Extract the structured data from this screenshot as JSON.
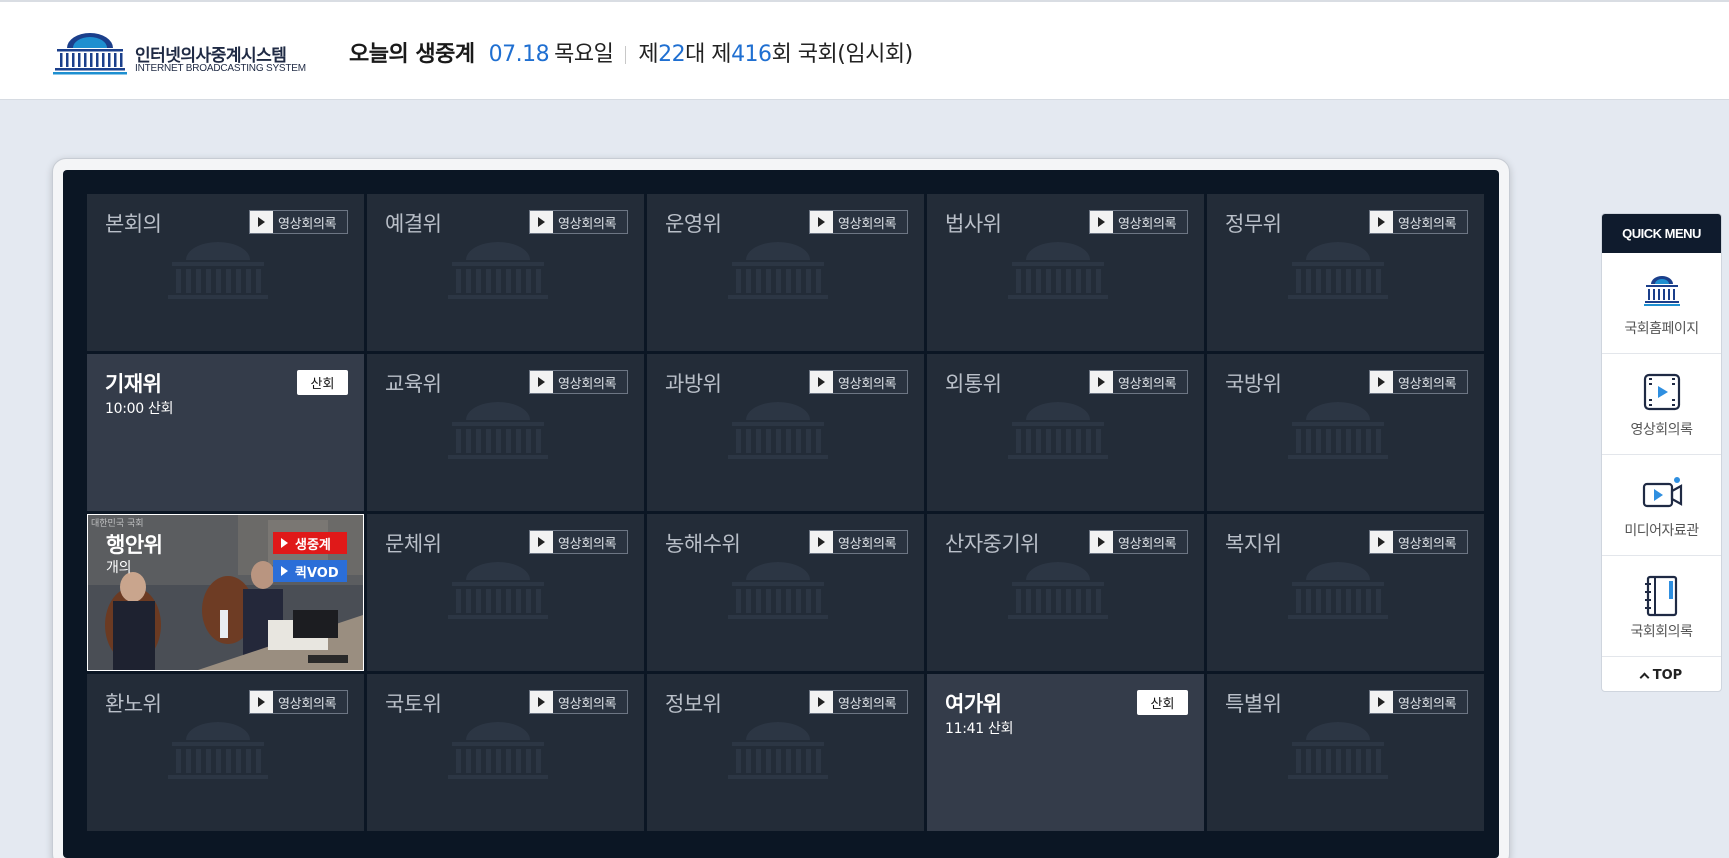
{
  "header": {
    "logo_kr": "인터넷의사중계시스템",
    "logo_en": "INTERNET BROADCASTING SYSTEM",
    "today_title": "오늘의 생중계",
    "date": "07.18",
    "weekday": "목요일",
    "session_prefix": "제",
    "session_num1": "22",
    "session_mid": "대 제",
    "session_num2": "416",
    "session_suffix": "회 국회(임시회)"
  },
  "video_button_label": "영상회의록",
  "tiles": [
    {
      "name": "본회의",
      "state": "idle"
    },
    {
      "name": "예결위",
      "state": "idle"
    },
    {
      "name": "운영위",
      "state": "idle"
    },
    {
      "name": "법사위",
      "state": "idle"
    },
    {
      "name": "정무위",
      "state": "idle"
    },
    {
      "name": "기재위",
      "state": "ended",
      "badge": "산회",
      "time": "10:00 산회"
    },
    {
      "name": "교육위",
      "state": "idle"
    },
    {
      "name": "과방위",
      "state": "idle"
    },
    {
      "name": "외통위",
      "state": "idle"
    },
    {
      "name": "국방위",
      "state": "idle"
    },
    {
      "name": "행안위",
      "state": "live",
      "status": "개의",
      "live_label": "생중계",
      "vod_label": "퀵VOD",
      "watermark": "대한민국 국회"
    },
    {
      "name": "문체위",
      "state": "idle"
    },
    {
      "name": "농해수위",
      "state": "idle"
    },
    {
      "name": "산자중기위",
      "state": "idle"
    },
    {
      "name": "복지위",
      "state": "idle"
    },
    {
      "name": "환노위",
      "state": "idle"
    },
    {
      "name": "국토위",
      "state": "idle"
    },
    {
      "name": "정보위",
      "state": "idle"
    },
    {
      "name": "여가위",
      "state": "ended",
      "badge": "산회",
      "time": "11:41 산회"
    },
    {
      "name": "특별위",
      "state": "idle"
    }
  ],
  "quick_menu": {
    "title": "QUICK MENU",
    "items": [
      {
        "label": "국회홈페이지",
        "icon": "assembly-icon"
      },
      {
        "label": "영상회의록",
        "icon": "video-record-icon"
      },
      {
        "label": "미디어자료관",
        "icon": "media-camera-icon"
      },
      {
        "label": "국회회의록",
        "icon": "minutes-book-icon"
      }
    ],
    "top_label": "TOP"
  },
  "colors": {
    "accent_blue": "#1f6fd1",
    "live_red": "#e01919",
    "vod_blue": "#2b6ed8",
    "screen_bg": "#0b1624",
    "tile_bg": "#232c38"
  }
}
